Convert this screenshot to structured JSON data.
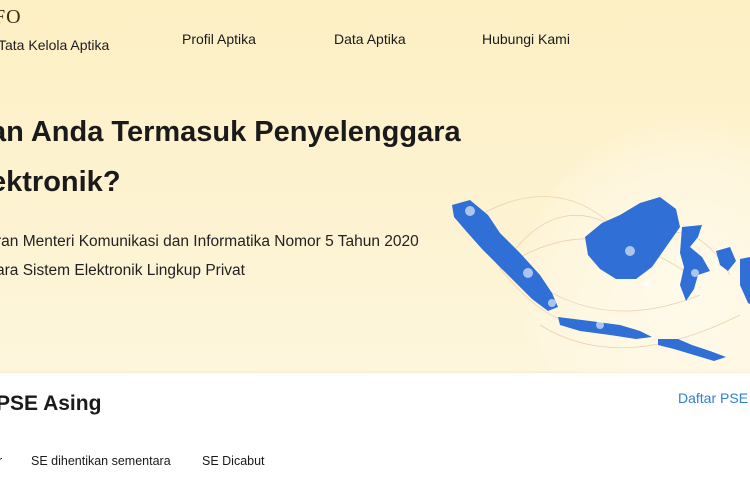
{
  "header": {
    "logo_text": "FO",
    "logo_subtitle": "Tata Kelola Aptika",
    "nav": [
      {
        "label": "Profil Aptika"
      },
      {
        "label": "Data Aptika"
      },
      {
        "label": "Hubungi Kami"
      }
    ]
  },
  "hero": {
    "headline_line1": "an Anda Termasuk Penyelenggara",
    "headline_line2": "ektronik?",
    "subline_line1": "ran Menteri Komunikasi dan Informatika Nomor 5 Tahun 2020",
    "subline_line2": "ara Sistem Elektronik Lingkup Privat",
    "map_icon": "indonesia-map-illustration",
    "map_color": "#2f6fd6"
  },
  "section": {
    "title": "PSE Asing",
    "daftar_link": "Daftar PSE",
    "tabs": [
      {
        "label": "r"
      },
      {
        "label": "SE dihentikan sementara"
      },
      {
        "label": "SE Dicabut"
      }
    ]
  },
  "colors": {
    "hero_bg": "#fdf0c4",
    "link": "#2f7fd0"
  }
}
